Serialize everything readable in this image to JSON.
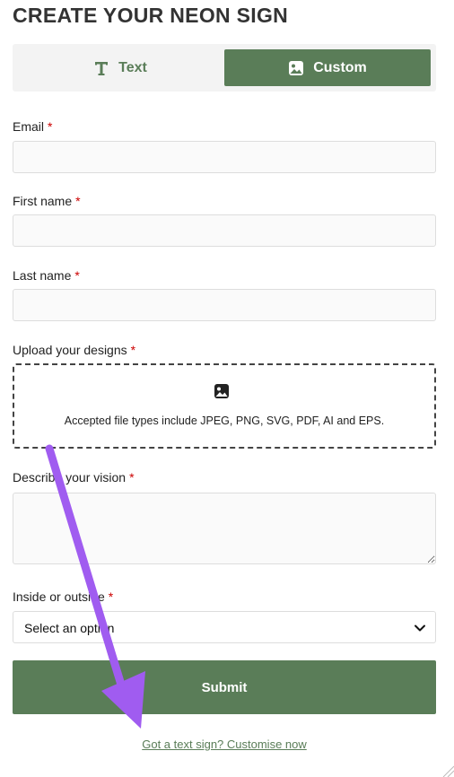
{
  "page": {
    "title": "CREATE YOUR NEON SIGN"
  },
  "tabs": [
    {
      "label": "Text",
      "icon": "text-type-icon",
      "active": false
    },
    {
      "label": "Custom",
      "icon": "image-icon",
      "active": true
    }
  ],
  "form": {
    "email": {
      "label": "Email",
      "value": "",
      "placeholder": ""
    },
    "first_name": {
      "label": "First name",
      "value": "",
      "placeholder": ""
    },
    "last_name": {
      "label": "Last name",
      "value": "",
      "placeholder": ""
    },
    "upload": {
      "label": "Upload your designs",
      "icon": "image-icon",
      "hint": "Accepted file types include JPEG, PNG, SVG, PDF, AI and EPS."
    },
    "vision": {
      "label": "Describe your vision",
      "value": ""
    },
    "placement": {
      "label": "Inside or outside",
      "selected": "Select an option"
    },
    "required_marker": "*",
    "submit_label": "Submit"
  },
  "footer": {
    "link_text": "Got a text sign? Customise now"
  },
  "colors": {
    "brand_green": "#5a7d58",
    "required_red": "#cc0000",
    "annotation_purple": "#a05cf0"
  }
}
